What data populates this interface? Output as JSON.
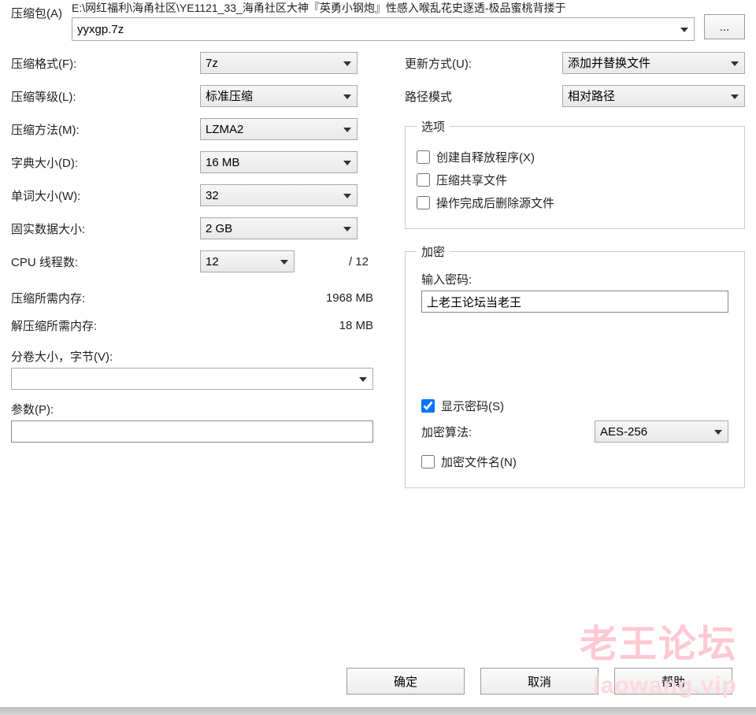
{
  "archive": {
    "label": "压缩包(A)",
    "path": "E:\\网红福利\\海甬社区\\YE1121_33_海甬社区大神『英勇小钢炮』性感入喉乱花史逐透-极品蜜桃背搂于",
    "file": "yyxgp.7z",
    "browse": "..."
  },
  "left": {
    "format": {
      "label": "压缩格式(F):",
      "value": "7z"
    },
    "level": {
      "label": "压缩等级(L):",
      "value": "标准压缩"
    },
    "method": {
      "label": "压缩方法(M):",
      "value": "LZMA2"
    },
    "dict": {
      "label": "字典大小(D):",
      "value": "16 MB"
    },
    "word": {
      "label": "单词大小(W):",
      "value": "32"
    },
    "solid": {
      "label": "固实数据大小:",
      "value": "2 GB"
    },
    "threads": {
      "label": "CPU 线程数:",
      "value": "12",
      "of": "/ 12"
    },
    "mem_pack": {
      "label": "压缩所需内存:",
      "value": "1968 MB"
    },
    "mem_unpack": {
      "label": "解压缩所需内存:",
      "value": "18 MB"
    },
    "split": {
      "label": "分卷大小，字节(V):",
      "value": ""
    },
    "params": {
      "label": "参数(P):",
      "value": ""
    }
  },
  "right": {
    "update": {
      "label": "更新方式(U):",
      "value": "添加并替换文件"
    },
    "pathmode": {
      "label": "路径模式",
      "value": "相对路径"
    },
    "options_legend": "选项",
    "opt_sfx": "创建自释放程序(X)",
    "opt_shared": "压缩共享文件",
    "opt_delete": "操作完成后删除源文件",
    "enc_legend": "加密",
    "enc_pw_label": "输入密码:",
    "enc_pw_value": "上老王论坛当老王",
    "enc_show": "显示密码(S)",
    "enc_algo_label": "加密算法:",
    "enc_algo_value": "AES-256",
    "enc_names": "加密文件名(N)"
  },
  "buttons": {
    "ok": "确定",
    "cancel": "取消",
    "help": "帮助"
  },
  "watermark": {
    "big": "老王论坛",
    "small": "laowang.vip"
  }
}
